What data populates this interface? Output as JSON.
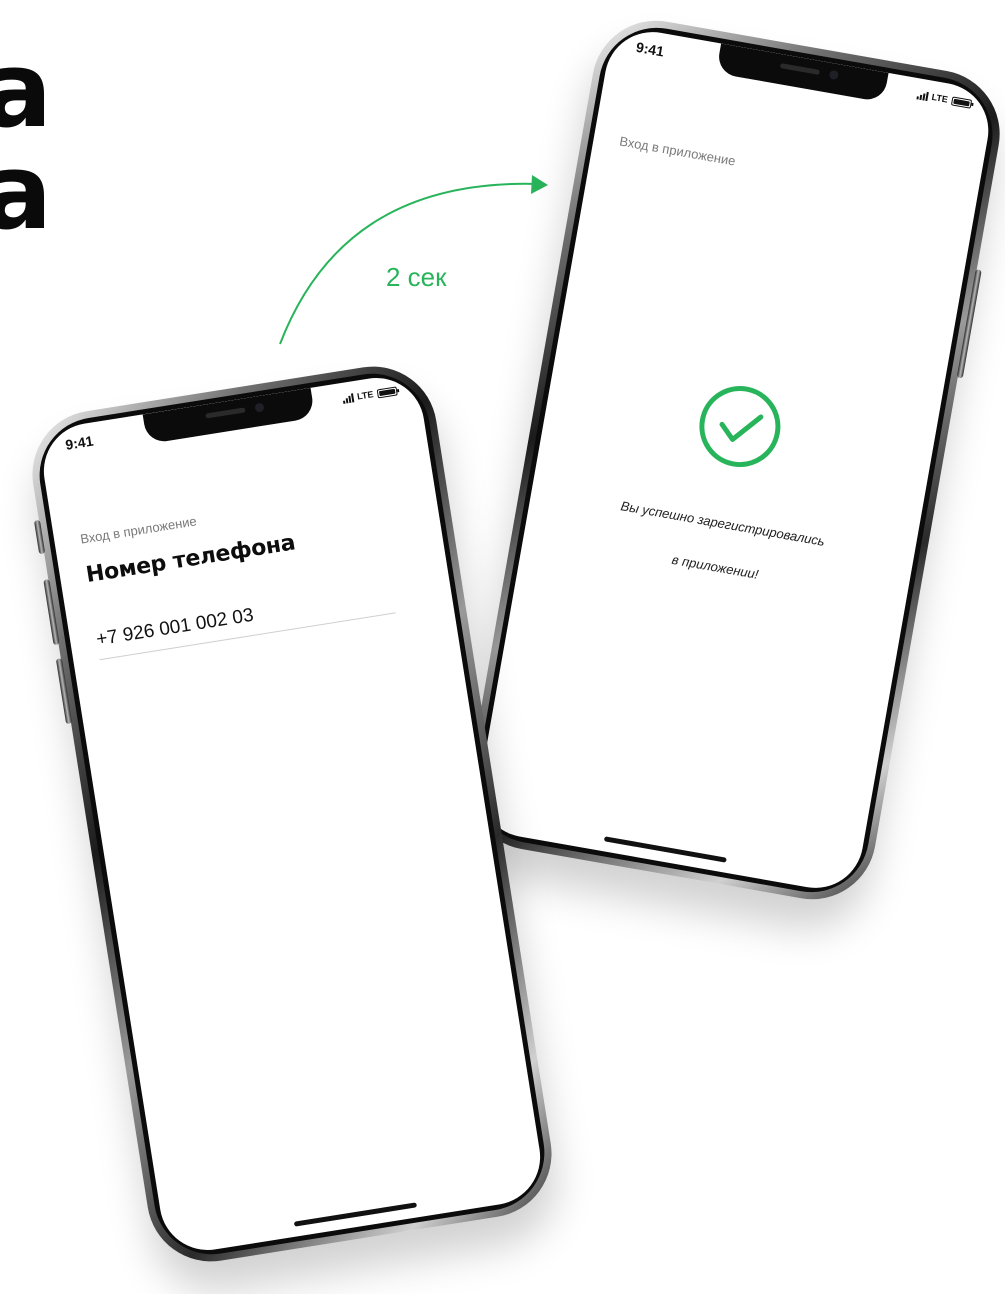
{
  "background": {
    "letters": [
      "a",
      "a"
    ]
  },
  "transition": {
    "label": "2 сек",
    "color": "#28b45a"
  },
  "phones": [
    {
      "status": {
        "time": "9:41",
        "network": "LTE",
        "signal_icon": "signal-bars-icon",
        "battery_icon": "battery-icon"
      },
      "screen": {
        "subtitle": "Вход в приложение",
        "heading": "Номер телефона",
        "phone_field": {
          "value": "+7 926 001 002 03"
        }
      }
    },
    {
      "status": {
        "time": "9:41",
        "network": "LTE",
        "signal_icon": "signal-bars-icon",
        "battery_icon": "battery-icon"
      },
      "screen": {
        "subtitle": "Вход в приложение",
        "success_icon": "check-circle-icon",
        "success_color": "#28b45a",
        "message_line_1": "Вы успешно зарегистрировались",
        "message_line_2": "в приложении!"
      }
    }
  ]
}
